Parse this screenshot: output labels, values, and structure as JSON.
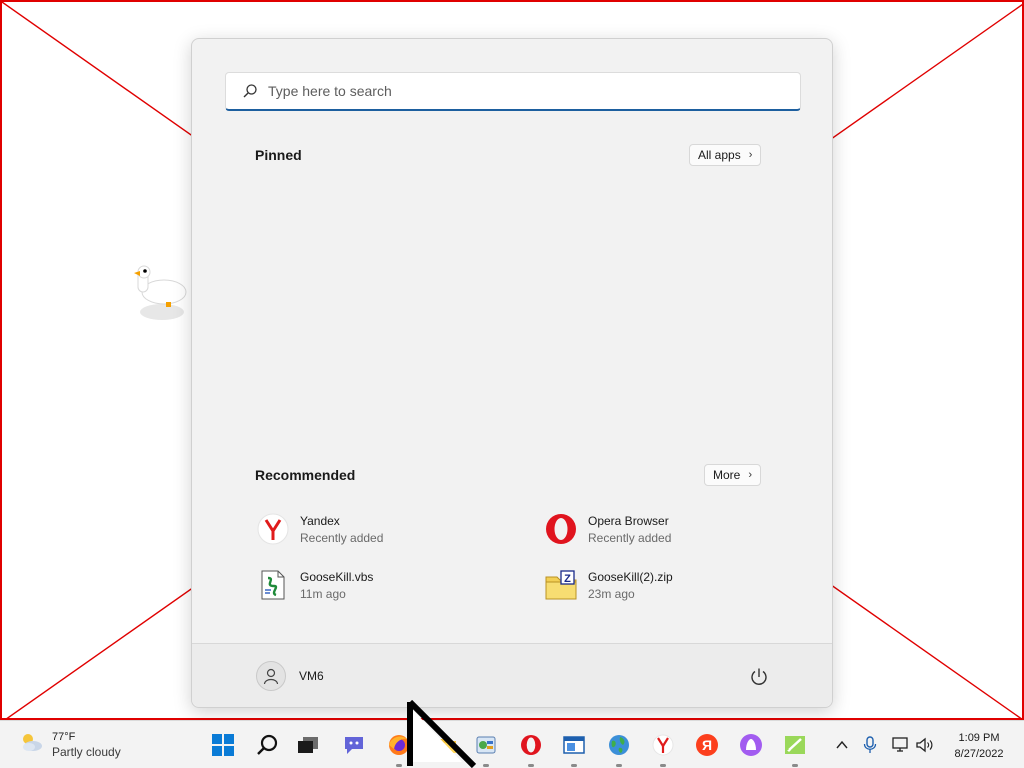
{
  "start_menu": {
    "search": {
      "placeholder": "Type here to search"
    },
    "pinned": {
      "title": "Pinned",
      "all_apps_label": "All apps"
    },
    "recommended": {
      "title": "Recommended",
      "more_label": "More",
      "items": [
        {
          "name": "Yandex",
          "sub": "Recently added",
          "icon": "yandex-browser-icon"
        },
        {
          "name": "Opera Browser",
          "sub": "Recently added",
          "icon": "opera-icon"
        },
        {
          "name": "GooseKill.vbs",
          "sub": "11m ago",
          "icon": "vbs-script-icon"
        },
        {
          "name": "GooseKill(2).zip",
          "sub": "23m ago",
          "icon": "zip-archive-icon"
        }
      ]
    },
    "footer": {
      "user_name": "VM6",
      "power_icon": "power-icon"
    }
  },
  "taskbar": {
    "weather": {
      "temp": "77°F",
      "condition": "Partly cloudy",
      "icon": "partly-cloudy-icon"
    },
    "apps": [
      "windows-start-icon",
      "search-icon",
      "task-view-icon",
      "chat-icon",
      "firefox-icon",
      "file-explorer-icon",
      "control-panel-icon",
      "opera-icon",
      "window-app-icon",
      "network-globe-icon",
      "yandex-browser-icon",
      "yandex-icon",
      "alice-assistant-icon",
      "notepad-icon"
    ],
    "tray": [
      "chevron-up-icon",
      "microphone-icon",
      "network-icon",
      "volume-icon"
    ],
    "clock": {
      "time": "1:09 PM",
      "date": "8/27/2022"
    }
  },
  "colors": {
    "accent": "#1d5f9f",
    "wallpaper_lines": "#e00000",
    "menu_bg": "#f2f2f2",
    "taskbar_bg": "#f3f3f3"
  }
}
